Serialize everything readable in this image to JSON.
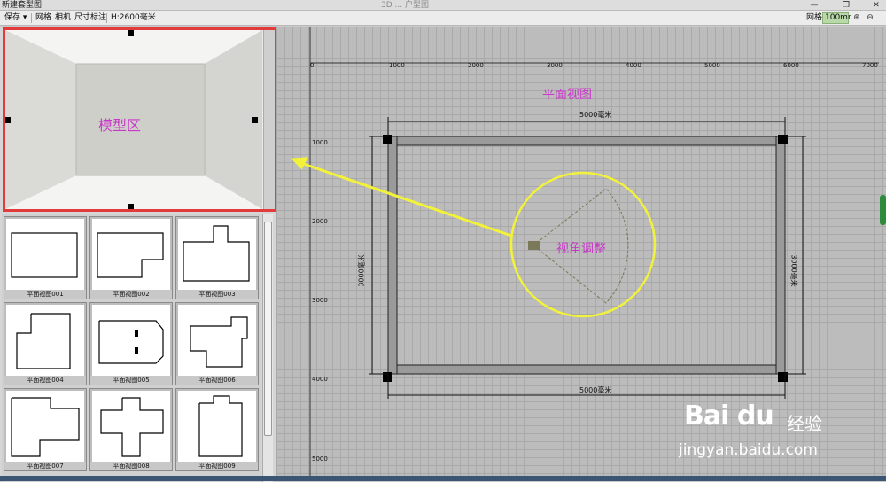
{
  "window": {
    "title": "新建套型图",
    "center_title": "3D ... 户型图"
  },
  "toolbar": {
    "save": "保存",
    "grid": "网格",
    "camera": "相机",
    "dimension": "尺寸标注",
    "height": "H:2600毫米",
    "right_grid": "网格",
    "zoom": "100mr"
  },
  "model_area": {
    "label": "模型区"
  },
  "plan": {
    "title": "平面视图",
    "angle_label": "视角调整",
    "dim_top": "5000毫米",
    "dim_bottom": "5000毫米",
    "dim_left": "3000毫米",
    "dim_right": "3000毫米"
  },
  "ruler_x": [
    "0",
    "1000",
    "2000",
    "3000",
    "4000",
    "5000",
    "6000",
    "7000"
  ],
  "ruler_y": [
    "1000",
    "2000",
    "3000",
    "4000",
    "5000"
  ],
  "thumbnails": [
    {
      "label": "平面视图001"
    },
    {
      "label": "平面视图002"
    },
    {
      "label": "平面视图003"
    },
    {
      "label": "平面视图004"
    },
    {
      "label": "平面视图005"
    },
    {
      "label": "平面视图006"
    },
    {
      "label": "平面视图007"
    },
    {
      "label": "平面视图008"
    },
    {
      "label": "平面视图009"
    }
  ],
  "watermark": {
    "logo": "Bai du",
    "cn": "经验",
    "url": "jingyan.baidu.com"
  },
  "colors": {
    "highlight_red": "#e33b3b",
    "annotation_magenta": "#c838c8",
    "arrow_yellow": "#f2f23a"
  },
  "icons": [
    "minimize-icon",
    "restore-icon",
    "close-icon",
    "zoom-in-icon",
    "zoom-out-icon",
    "camera-icon",
    "dropdown-icon"
  ]
}
